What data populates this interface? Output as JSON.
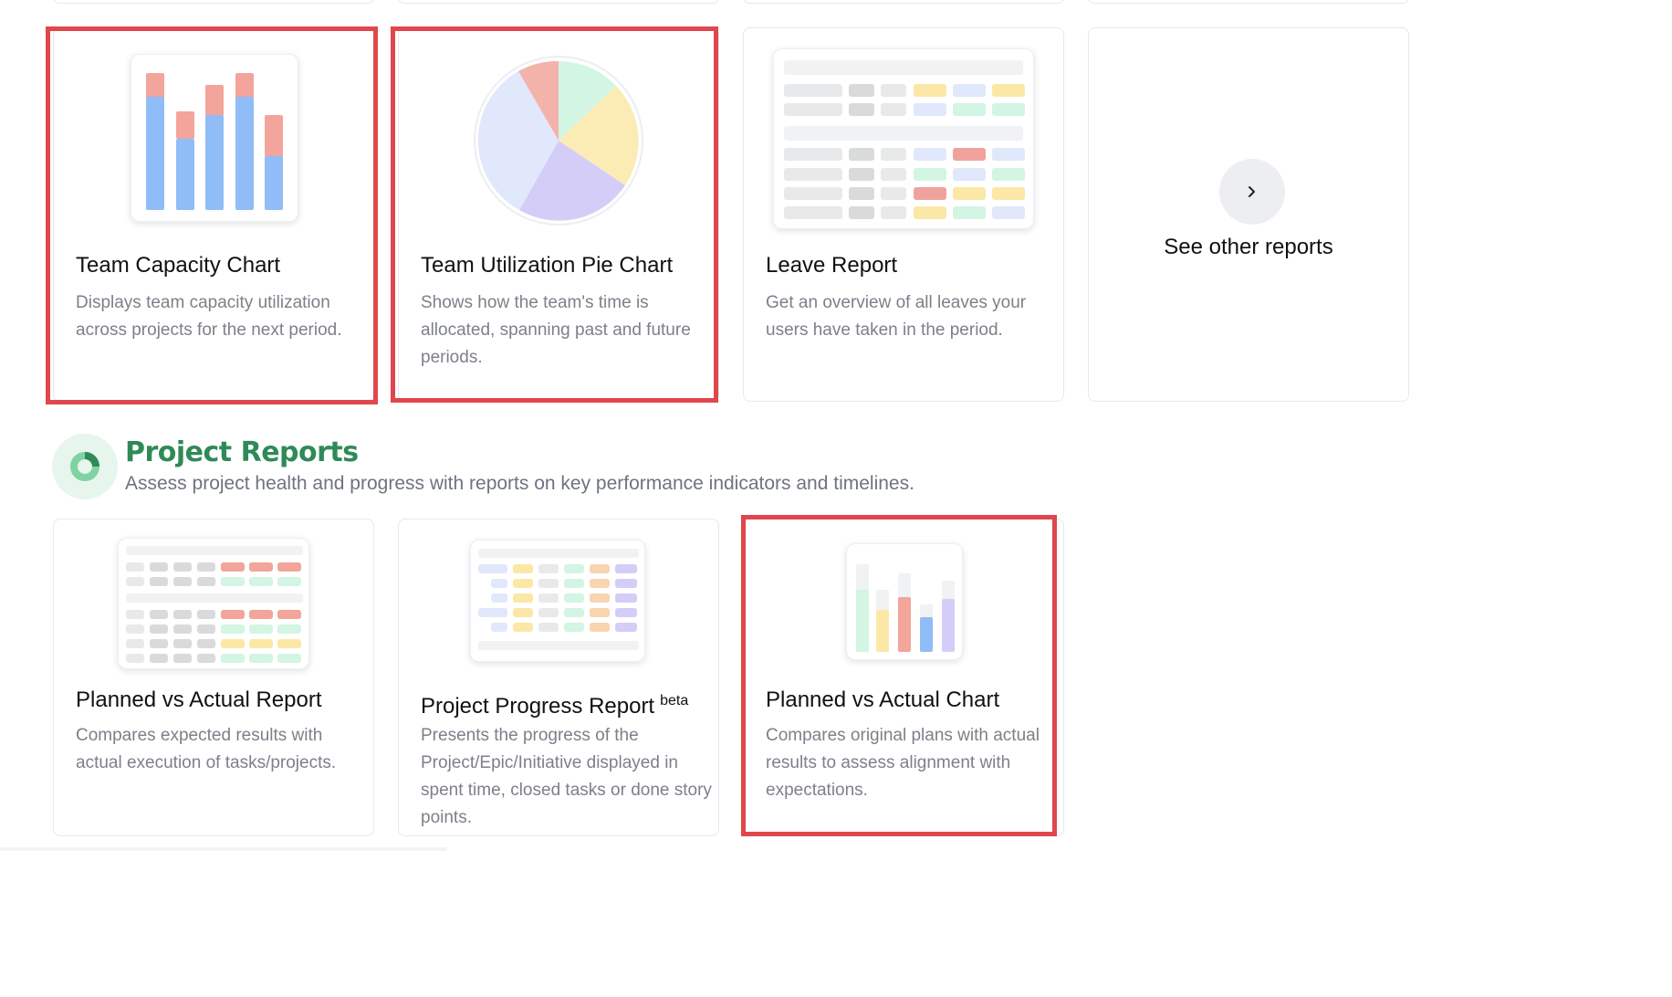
{
  "team_cards": [
    {
      "title": "Team Capacity Chart",
      "desc": "Displays team capacity utilization across projects for the next period."
    },
    {
      "title": "Team Utilization Pie Chart",
      "desc": "Shows how the team's time is allocated, spanning past and future periods."
    },
    {
      "title": "Leave Report",
      "desc": "Get an overview of all leaves your users have taken in the period."
    }
  ],
  "see_other": {
    "label": "See other reports",
    "icon": "chevron-right-icon"
  },
  "project_section": {
    "title": "Project Reports",
    "subtitle": "Assess project health and progress with reports on key performance indicators and timelines.",
    "icon": "donut-chart-icon",
    "accent": "#2f8a57"
  },
  "project_cards": [
    {
      "title": "Planned vs Actual Report",
      "desc": "Compares expected results with actual execution of tasks/projects."
    },
    {
      "title": "Project Progress Report",
      "badge": "beta",
      "desc": "Presents the progress of the Project/Epic/Initiative displayed in spent time, closed tasks or done story points."
    },
    {
      "title": "Planned vs Actual Chart",
      "desc": "Compares original plans with actual results to assess alignment with expectations."
    }
  ],
  "colors": {
    "highlight": "#e0474c",
    "blue": "#90bcf7",
    "salmon": "#f3a49b",
    "green": "#d3f5e3",
    "yellow": "#fbebb5",
    "lavender": "#d4cdf8",
    "light_blue": "#e1e8fb"
  }
}
